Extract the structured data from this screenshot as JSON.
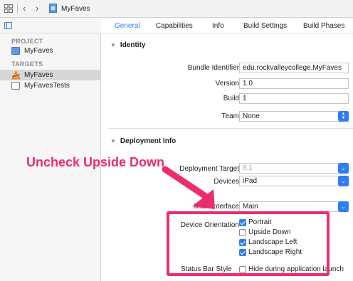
{
  "toolbar": {
    "project_name": "MyFaves"
  },
  "sidebar": {
    "project_header": "PROJECT",
    "project_item": "MyFaves",
    "targets_header": "TARGETS",
    "targets": [
      {
        "label": "MyFaves",
        "selected": true
      },
      {
        "label": "MyFavesTests",
        "selected": false
      }
    ]
  },
  "tabs": [
    {
      "label": "General",
      "active": true
    },
    {
      "label": "Capabilities",
      "active": false
    },
    {
      "label": "Info",
      "active": false
    },
    {
      "label": "Build Settings",
      "active": false
    },
    {
      "label": "Build Phases",
      "active": false
    }
  ],
  "identity": {
    "title": "Identity",
    "bundle_identifier_label": "Bundle Identifier",
    "bundle_identifier_value": "edu.rockvalleycollege.MyFaves",
    "version_label": "Version",
    "version_value": "1.0",
    "build_label": "Build",
    "build_value": "1",
    "team_label": "Team",
    "team_value": "None"
  },
  "deployment": {
    "title": "Deployment Info",
    "target_label": "Deployment Target",
    "target_value": "8.1",
    "devices_label": "Devices",
    "devices_value": "iPad",
    "main_interface_label": "Main Interface",
    "main_interface_value": "Main",
    "orientation_label": "Device Orientation",
    "orientations": [
      {
        "label": "Portrait",
        "checked": true
      },
      {
        "label": "Upside Down",
        "checked": false
      },
      {
        "label": "Landscape Left",
        "checked": true
      },
      {
        "label": "Landscape Right",
        "checked": true
      }
    ],
    "status_bar_label": "Status Bar Style",
    "hide_status_label": "Hide during application launch",
    "hide_status_checked": false
  },
  "annotation": {
    "text": "Uncheck Upside Down",
    "color": "#ec2d6b"
  },
  "colors": {
    "accent": "#2f7df6"
  }
}
